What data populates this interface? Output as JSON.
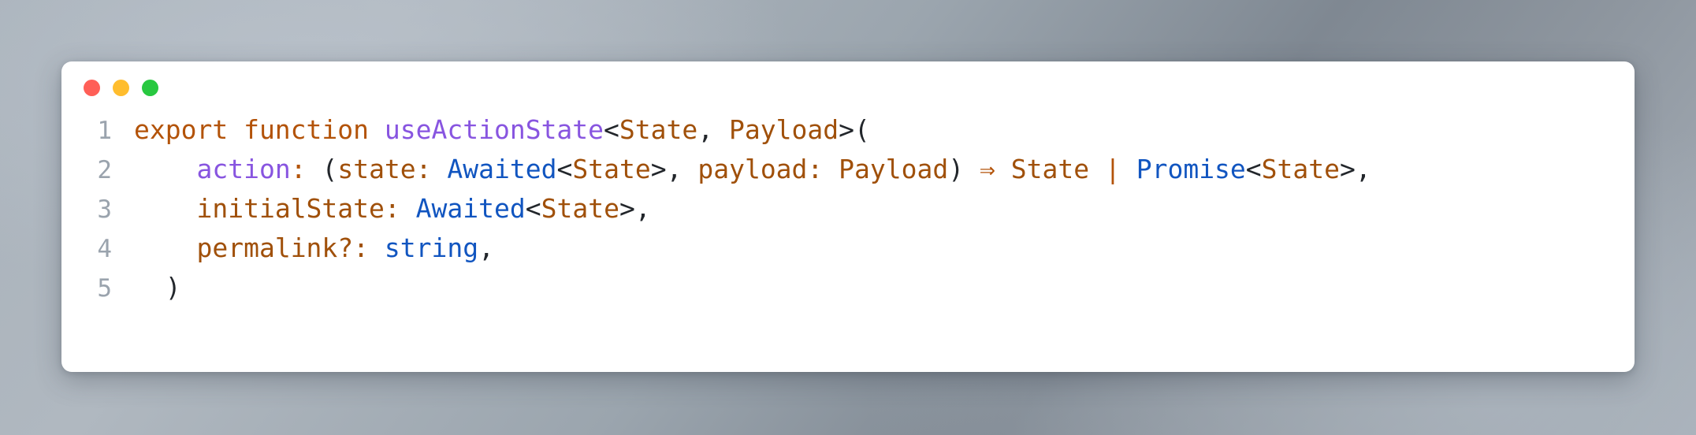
{
  "window": {
    "traffic_lights": [
      {
        "name": "close-button",
        "color": "#ff5f57"
      },
      {
        "name": "minimize-button",
        "color": "#ffbd2e"
      },
      {
        "name": "maximize-button",
        "color": "#28c840"
      }
    ]
  },
  "palette": {
    "background_gradient_from": "#a9b2bb",
    "background_gradient_to": "#8e969f",
    "card_background": "#ffffff",
    "line_number": "#9aa3ad",
    "keyword": "#b35309",
    "function_name": "#8855e0",
    "property": "#8855e0",
    "variable": "#a0500a",
    "type": "#1155c0",
    "punctuation": "#22262b",
    "operator": "#b35309"
  },
  "code": {
    "language": "typescript",
    "full_text": "export function useActionState<State, Payload>(\n    action: (state: Awaited<State>, payload: Payload) => State | Promise<State>,\n    initialState: Awaited<State>,\n    permalink?: string,\n  )",
    "lines": [
      {
        "number": "1",
        "text": "export function useActionState<State, Payload>(",
        "tokens": [
          {
            "t": "export function ",
            "c": "t-kw"
          },
          {
            "t": "useActionState",
            "c": "t-fn"
          },
          {
            "t": "<",
            "c": "t-punc"
          },
          {
            "t": "State",
            "c": "t-var"
          },
          {
            "t": ", ",
            "c": "t-punc"
          },
          {
            "t": "Payload",
            "c": "t-var"
          },
          {
            "t": ">(",
            "c": "t-punc"
          }
        ]
      },
      {
        "number": "2",
        "text": "    action: (state: Awaited<State>, payload: Payload) => State | Promise<State>,",
        "tokens": [
          {
            "t": "    ",
            "c": "t-plain"
          },
          {
            "t": "action",
            "c": "t-prop"
          },
          {
            "t": ":",
            "c": "t-op"
          },
          {
            "t": " ",
            "c": "t-plain"
          },
          {
            "t": "(",
            "c": "t-punc"
          },
          {
            "t": "state",
            "c": "t-var"
          },
          {
            "t": ":",
            "c": "t-var"
          },
          {
            "t": " ",
            "c": "t-plain"
          },
          {
            "t": "Awaited",
            "c": "t-type"
          },
          {
            "t": "<",
            "c": "t-punc"
          },
          {
            "t": "State",
            "c": "t-var"
          },
          {
            "t": ">",
            "c": "t-punc"
          },
          {
            "t": ", ",
            "c": "t-punc"
          },
          {
            "t": "payload",
            "c": "t-var"
          },
          {
            "t": ":",
            "c": "t-var"
          },
          {
            "t": " ",
            "c": "t-plain"
          },
          {
            "t": "Payload",
            "c": "t-var"
          },
          {
            "t": ")",
            "c": "t-punc"
          },
          {
            "t": " ",
            "c": "t-plain"
          },
          {
            "t": "⇒",
            "c": "arrow"
          },
          {
            "t": " ",
            "c": "t-plain"
          },
          {
            "t": "State",
            "c": "t-var"
          },
          {
            "t": " ",
            "c": "t-plain"
          },
          {
            "t": "|",
            "c": "t-op"
          },
          {
            "t": " ",
            "c": "t-plain"
          },
          {
            "t": "Promise",
            "c": "t-type"
          },
          {
            "t": "<",
            "c": "t-punc"
          },
          {
            "t": "State",
            "c": "t-var"
          },
          {
            "t": ">,",
            "c": "t-punc"
          }
        ]
      },
      {
        "number": "3",
        "text": "    initialState: Awaited<State>,",
        "tokens": [
          {
            "t": "    ",
            "c": "t-plain"
          },
          {
            "t": "initialState",
            "c": "t-var"
          },
          {
            "t": ":",
            "c": "t-var"
          },
          {
            "t": " ",
            "c": "t-plain"
          },
          {
            "t": "Awaited",
            "c": "t-type"
          },
          {
            "t": "<",
            "c": "t-punc"
          },
          {
            "t": "State",
            "c": "t-var"
          },
          {
            "t": ">,",
            "c": "t-punc"
          }
        ]
      },
      {
        "number": "4",
        "text": "    permalink?: string,",
        "tokens": [
          {
            "t": "    ",
            "c": "t-plain"
          },
          {
            "t": "permalink",
            "c": "t-var"
          },
          {
            "t": "?:",
            "c": "t-var"
          },
          {
            "t": " ",
            "c": "t-plain"
          },
          {
            "t": "string",
            "c": "t-type"
          },
          {
            "t": ",",
            "c": "t-punc"
          }
        ]
      },
      {
        "number": "5",
        "text": "  )",
        "tokens": [
          {
            "t": "  ",
            "c": "t-plain"
          },
          {
            "t": ")",
            "c": "t-punc"
          }
        ]
      }
    ]
  }
}
